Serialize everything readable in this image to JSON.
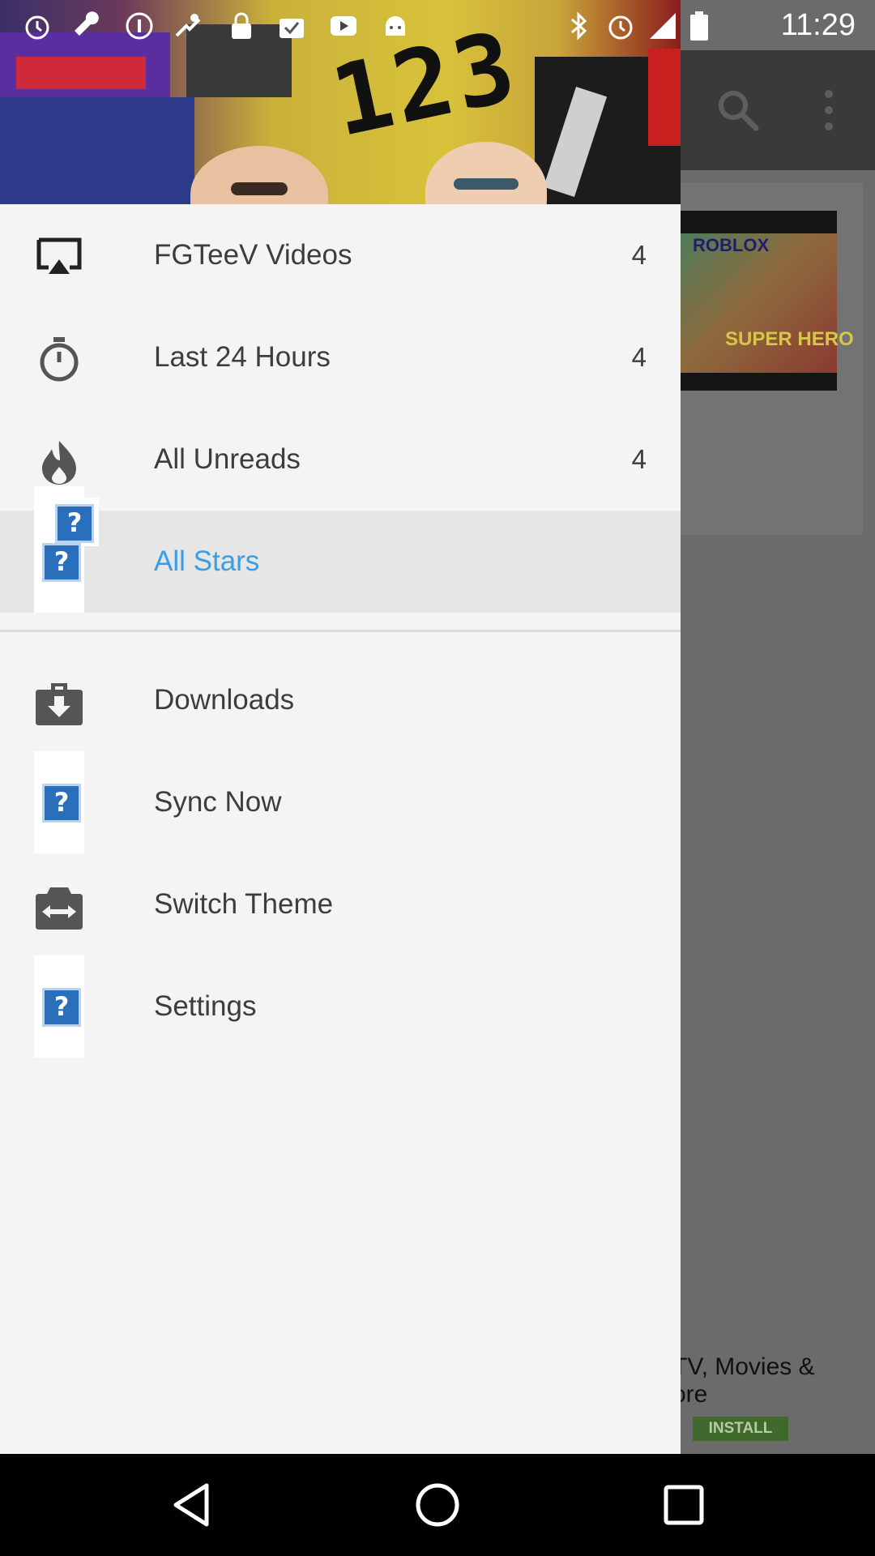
{
  "status_bar": {
    "time": "11:29",
    "left_icons": [
      "alarm-icon",
      "wrench-icon",
      "info-icon",
      "fake-gps-icon",
      "lock-icon",
      "briefcase-check-icon",
      "youtube-icon",
      "android-icon"
    ],
    "right_icons": [
      "bluetooth-icon",
      "alarm-icon",
      "signal-icon",
      "battery-icon"
    ]
  },
  "drawer": {
    "header_art_text": "123",
    "menu": [
      {
        "label": "FGTeeV Videos",
        "count": "4",
        "icon": "cast-screen-icon"
      },
      {
        "label": "Last 24 Hours",
        "count": "4",
        "icon": "stopwatch-icon"
      },
      {
        "label": "All Unreads",
        "count": "4",
        "icon": "flame-icon"
      },
      {
        "label": "All Stars",
        "count": "",
        "icon": "missing-image-icon",
        "active": true
      }
    ],
    "secondary": [
      {
        "label": "Downloads",
        "icon": "download-briefcase-icon"
      },
      {
        "label": "Sync Now",
        "icon": "missing-image-icon"
      },
      {
        "label": "Switch Theme",
        "icon": "switch-camera-icon"
      },
      {
        "label": "Settings",
        "icon": "missing-image-icon"
      }
    ]
  },
  "background": {
    "ad_text": "TV, Movies &\nore",
    "install_label": "INSTALL",
    "thumb_title": "ROBLOX",
    "thumb_caption": "SUPER HERO"
  },
  "colors": {
    "accent": "#3a9ee4",
    "drawer_bg": "#f4f4f4",
    "active_row": "#e6e6e6",
    "scrim": "#666666"
  }
}
